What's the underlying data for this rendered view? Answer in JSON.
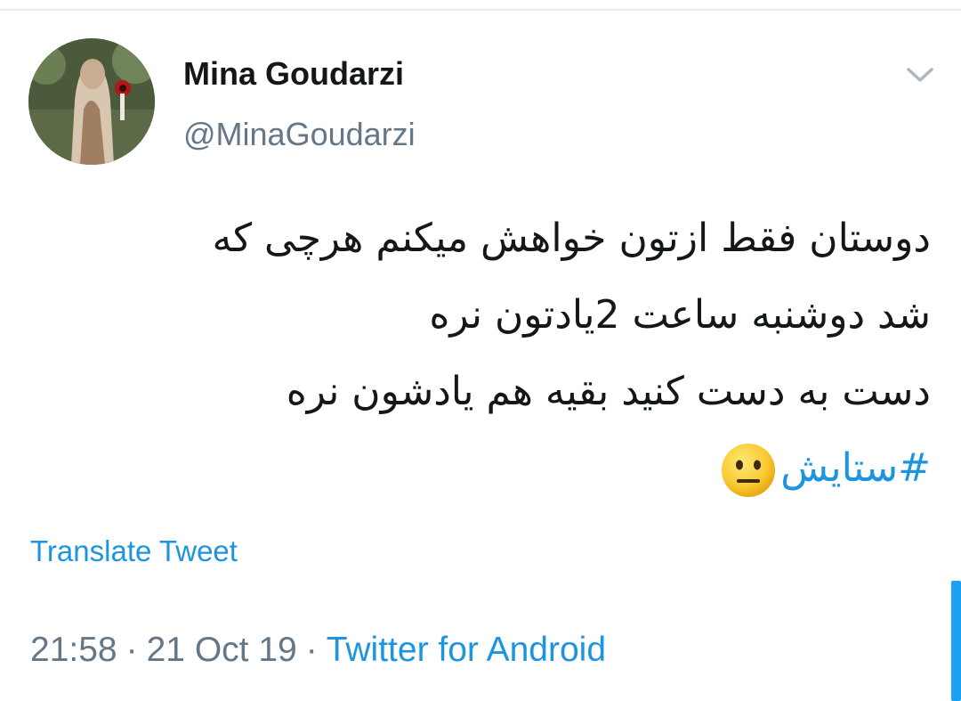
{
  "tweet": {
    "display_name": "Mina Goudarzi",
    "handle": "@MinaGoudarzi",
    "lines": [
      "دوستان فقط ازتون خواهش میکنم هرچی که",
      "شد دوشنبه ساعت 2یادتون نره",
      "دست به دست کنید بقیه هم یادشون نره"
    ],
    "hashtag": "#ستایش",
    "emoji": "neutral-face-emoji",
    "translate_label": "Translate Tweet",
    "time": "21:58",
    "separator": "·",
    "date": "21 Oct 19",
    "source": "Twitter for Android"
  },
  "icons": {
    "caret": "chevron-down-icon"
  },
  "colors": {
    "link": "#1b95e0",
    "secondary_text": "#657786",
    "primary_text": "#14171a",
    "scrollbar": "#1da1f2"
  }
}
